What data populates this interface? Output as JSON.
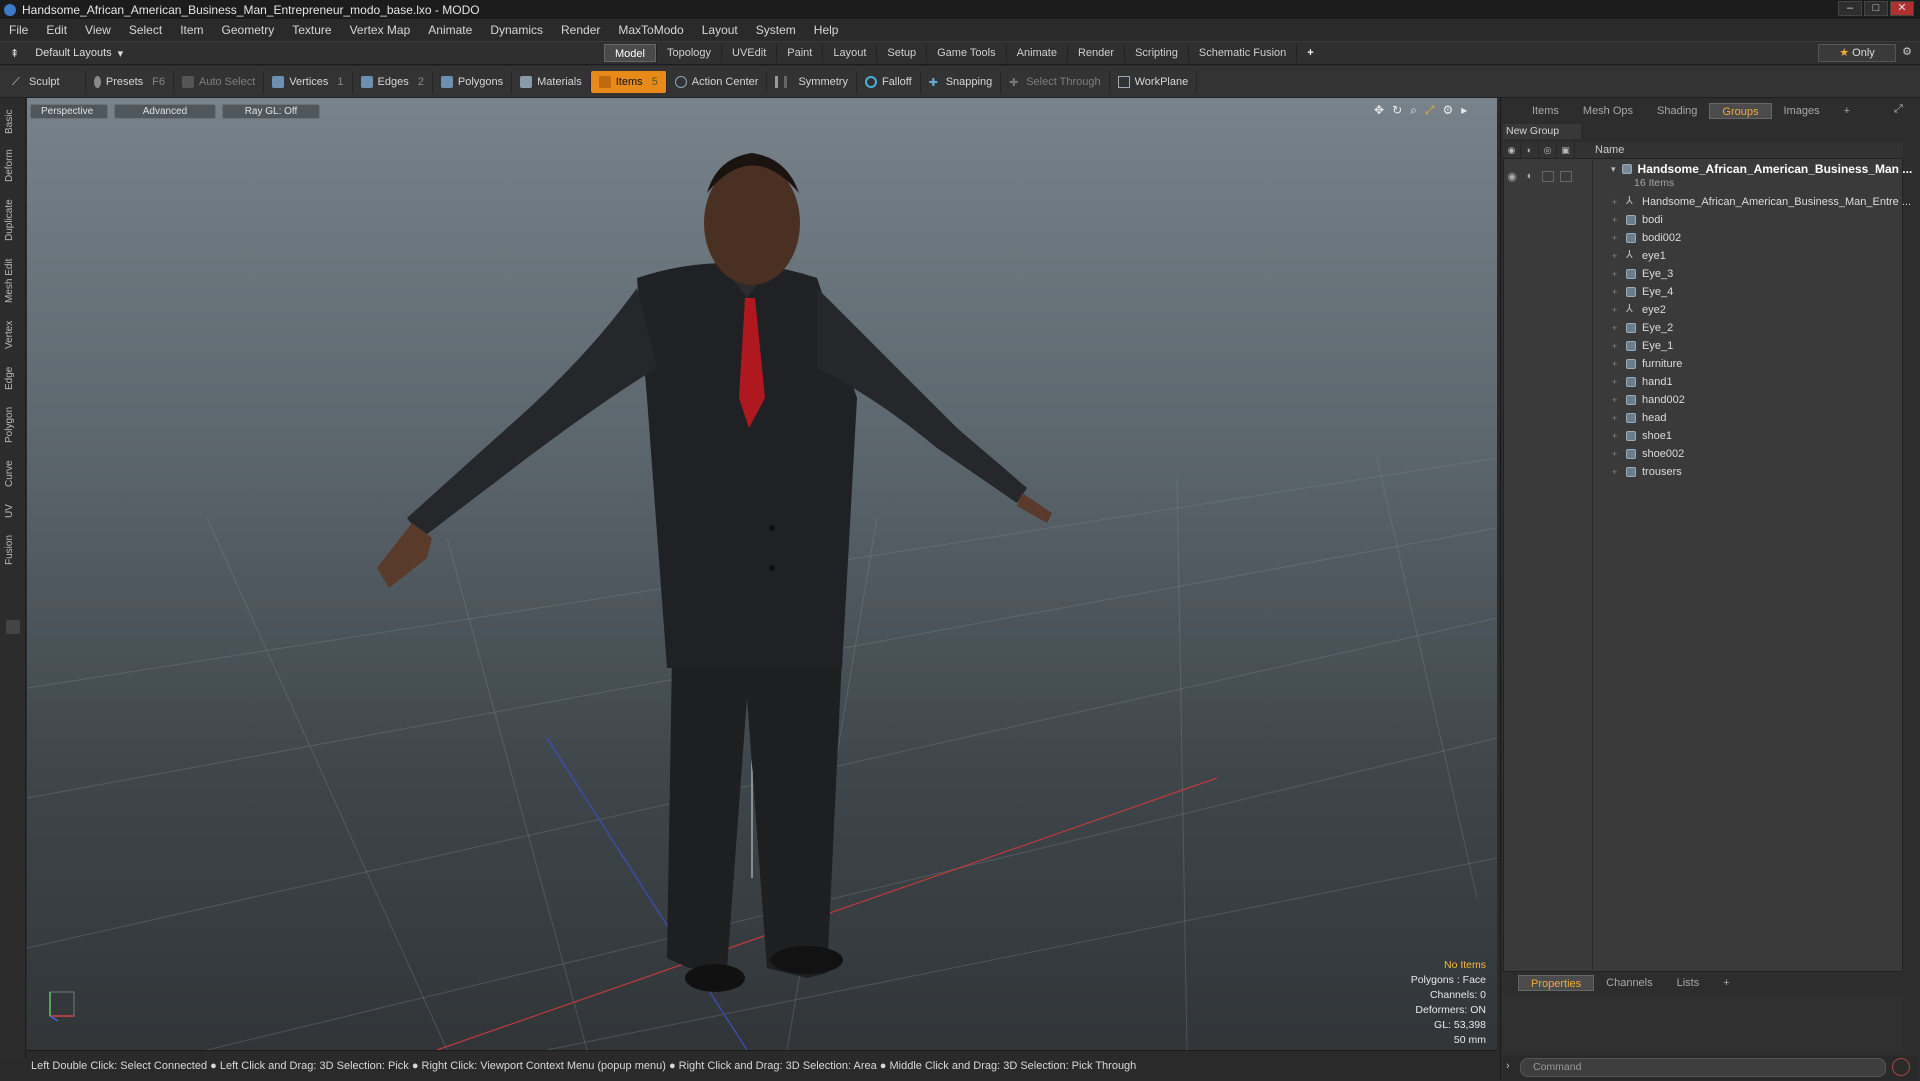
{
  "window": {
    "title": "Handsome_African_American_Business_Man_Entrepreneur_modo_base.lxo - MODO"
  },
  "menu": [
    "File",
    "Edit",
    "View",
    "Select",
    "Item",
    "Geometry",
    "Texture",
    "Vertex Map",
    "Animate",
    "Dynamics",
    "Render",
    "MaxToModo",
    "Layout",
    "System",
    "Help"
  ],
  "layout_selector": "Default Layouts",
  "mode_tabs": [
    "Model",
    "Topology",
    "UVEdit",
    "Paint",
    "Layout",
    "Setup",
    "Game Tools",
    "Animate",
    "Render",
    "Scripting",
    "Schematic Fusion"
  ],
  "active_mode_tab": "Model",
  "only_label": "Only",
  "toolbar": {
    "sculpt": "Sculpt",
    "presets": "Presets",
    "presets_key": "F6",
    "auto_select": "Auto Select",
    "vertices": "Vertices",
    "vertices_count": "1",
    "edges": "Edges",
    "edges_count": "2",
    "polygons": "Polygons",
    "materials": "Materials",
    "items": "Items",
    "items_count": "5",
    "action_center": "Action Center",
    "symmetry": "Symmetry",
    "falloff": "Falloff",
    "snapping": "Snapping",
    "select_through": "Select Through",
    "workplane": "WorkPlane"
  },
  "left_tabs": [
    "Basic",
    "Deform",
    "Duplicate",
    "Mesh Edit",
    "Vertex",
    "Edge",
    "Polygon",
    "Curve",
    "UV",
    "Fusion"
  ],
  "viewport": {
    "perspective": "Perspective",
    "advanced": "Advanced",
    "raygl": "Ray GL: Off",
    "stats": {
      "no_items": "No Items",
      "polygons": "Polygons : Face",
      "channels": "Channels: 0",
      "deformers": "Deformers: ON",
      "gl": "GL: 53,398",
      "size": "50 mm"
    }
  },
  "statusbar": "Left Double Click: Select Connected ● Left Click and Drag: 3D Selection: Pick ● Right Click: Viewport Context Menu (popup menu) ● Right Click and Drag: 3D Selection: Area ● Middle Click and Drag: 3D Selection: Pick Through",
  "right_tabs": [
    "Items",
    "Mesh Ops",
    "Shading",
    "Groups",
    "Images"
  ],
  "active_right_tab": "Groups",
  "new_group": "New Group",
  "list_header": "Name",
  "group": {
    "root": "Handsome_African_American_Business_Man ...",
    "sub": "16 Items",
    "items": [
      {
        "name": "Handsome_African_American_Business_Man_Entre ...",
        "icon": "locator-icon"
      },
      {
        "name": "bodi",
        "icon": "mesh-icon"
      },
      {
        "name": "bodi002",
        "icon": "mesh-icon"
      },
      {
        "name": "eye1",
        "icon": "locator-icon"
      },
      {
        "name": "Eye_3",
        "icon": "mesh-icon"
      },
      {
        "name": "Eye_4",
        "icon": "mesh-icon"
      },
      {
        "name": "eye2",
        "icon": "locator-icon"
      },
      {
        "name": "Eye_2",
        "icon": "mesh-icon"
      },
      {
        "name": "Eye_1",
        "icon": "mesh-icon"
      },
      {
        "name": "furniture",
        "icon": "mesh-icon"
      },
      {
        "name": "hand1",
        "icon": "mesh-icon"
      },
      {
        "name": "hand002",
        "icon": "mesh-icon"
      },
      {
        "name": "head",
        "icon": "mesh-icon"
      },
      {
        "name": "shoe1",
        "icon": "mesh-icon"
      },
      {
        "name": "shoe002",
        "icon": "mesh-icon"
      },
      {
        "name": "trousers",
        "icon": "mesh-icon"
      }
    ]
  },
  "prop_tabs": [
    "Properties",
    "Channels",
    "Lists"
  ],
  "active_prop_tab": "Properties",
  "command_placeholder": "Command"
}
